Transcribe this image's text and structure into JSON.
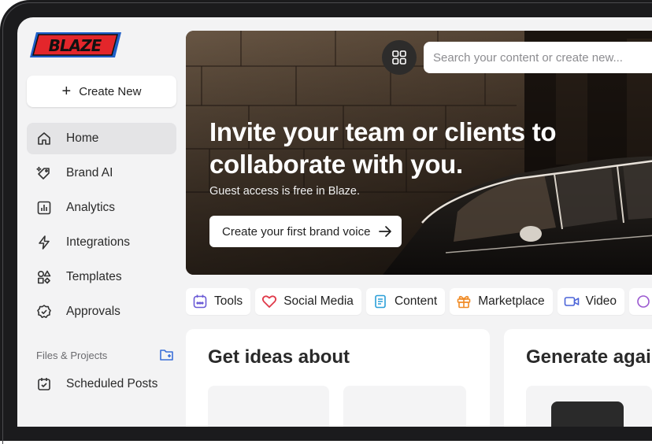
{
  "app": {
    "logo_text": "BLAZE"
  },
  "sidebar": {
    "create_label": "Create New",
    "items": [
      {
        "label": "Home",
        "icon": "home-icon",
        "active": true
      },
      {
        "label": "Brand AI",
        "icon": "tag-sparkle-icon"
      },
      {
        "label": "Analytics",
        "icon": "chart-icon"
      },
      {
        "label": "Integrations",
        "icon": "lightning-icon"
      },
      {
        "label": "Templates",
        "icon": "shapes-icon"
      },
      {
        "label": "Approvals",
        "icon": "badge-check-icon"
      }
    ],
    "section_label": "Files & Projects",
    "section_items": [
      {
        "label": "Scheduled Posts",
        "icon": "calendar-check-icon"
      }
    ]
  },
  "header": {
    "search_placeholder": "Search your content or create new..."
  },
  "hero": {
    "title": "Invite your team or clients to collaborate with you.",
    "subtitle": "Guest access is free in Blaze.",
    "cta_label": "Create your first brand voice"
  },
  "chips": [
    {
      "label": "Tools",
      "icon": "calendar-icon",
      "color": "#6b5bd6"
    },
    {
      "label": "Social Media",
      "icon": "heart-icon",
      "color": "#e03a4a"
    },
    {
      "label": "Content",
      "icon": "document-icon",
      "color": "#2a9fd8"
    },
    {
      "label": "Marketplace",
      "icon": "gift-icon",
      "color": "#f08a24"
    },
    {
      "label": "Video",
      "icon": "video-icon",
      "color": "#4a63d8"
    }
  ],
  "cards": [
    {
      "title": "Get ideas about"
    },
    {
      "title": "Generate agai"
    }
  ],
  "colors": {
    "logo_red": "#e3262b",
    "logo_blue": "#1f5fc8",
    "accent_blue": "#3b6fd8"
  }
}
